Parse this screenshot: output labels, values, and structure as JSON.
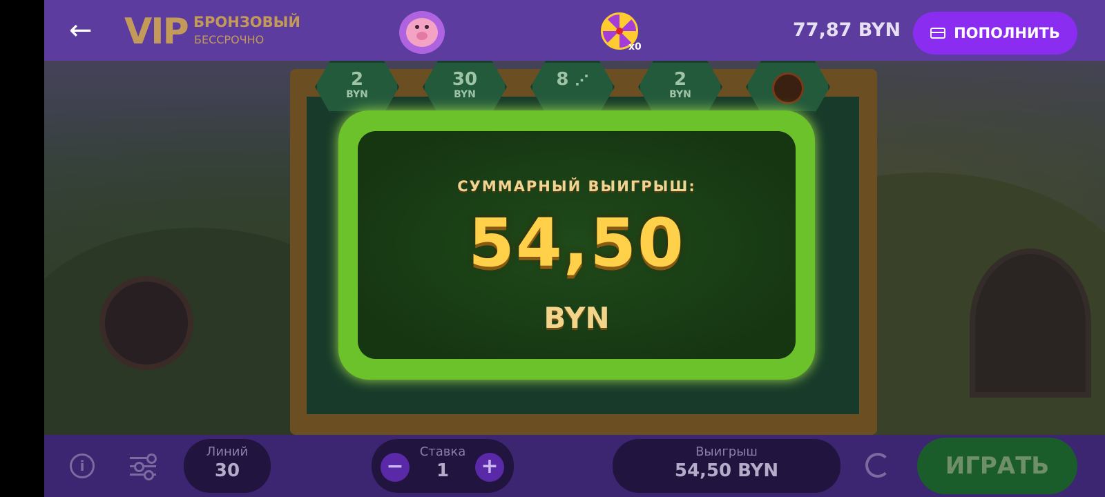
{
  "header": {
    "vip_label": "VIP",
    "vip_level": "БРОНЗОВЫЙ",
    "vip_term": "БЕССРОЧНО",
    "wheel_count": "x0",
    "balance": "77,87 BYN",
    "deposit_label": "ПОПОЛНИТЬ",
    "icons": {
      "back": "back-arrow-icon",
      "piggy": "piggy-bank-icon",
      "wheel": "fortune-wheel-icon",
      "card": "credit-card-icon"
    }
  },
  "jackpots": [
    {
      "value": "2",
      "currency": "BYN"
    },
    {
      "value": "30",
      "currency": "BYN"
    },
    {
      "value": "8",
      "currency": "⋰"
    },
    {
      "value": "2",
      "currency": "BYN"
    },
    {
      "value": "",
      "currency": ""
    }
  ],
  "win_panel": {
    "title": "СУММАРНЫЙ ВЫИГРЫШ:",
    "amount": "54,50",
    "currency": "BYN"
  },
  "controls": {
    "lines_label": "Линий",
    "lines_value": "30",
    "bet_label": "Ставка",
    "bet_value": "1",
    "minus": "−",
    "plus": "+",
    "win_label": "Выигрыш",
    "win_value": "54,50 BYN",
    "play_label": "ИГРАТЬ",
    "info": "i"
  },
  "colors": {
    "accent": "#8b2df0",
    "topbar": "#5c3c9e",
    "bottombar": "#3c2672",
    "play": "#1a5c2a",
    "gold": "#ffd04a"
  }
}
